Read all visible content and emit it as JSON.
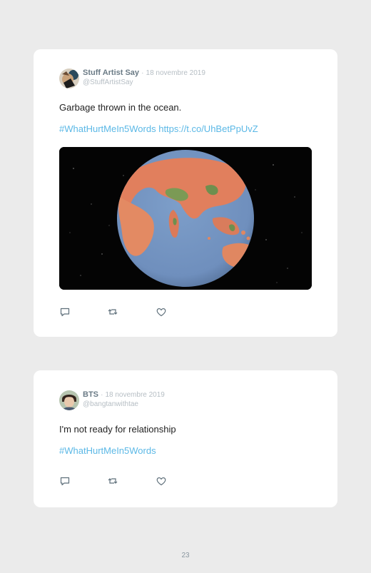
{
  "tweets": [
    {
      "author": "Stuff Artist Say",
      "separator": "·",
      "date": "18 novembre 2019",
      "handle": "@StuffArtistSay",
      "text": "Garbage thrown in the ocean.",
      "hashtag": "#WhatHurtMeIn5Words",
      "link": "https://t.co/UhBetPpUvZ",
      "media": "globe-image",
      "actions": [
        "reply-icon",
        "retweet-icon",
        "like-icon"
      ]
    },
    {
      "author": "BTS",
      "separator": "·",
      "date": "18 novembre 2019",
      "handle": "@bangtanwithtae",
      "text": "I'm not ready for relationship",
      "hashtag": "#WhatHurtMeIn5Words",
      "actions": [
        "reply-icon",
        "retweet-icon",
        "like-icon"
      ]
    }
  ],
  "page": {
    "number": "23"
  },
  "colors": {
    "background": "#ebebeb",
    "card": "#ffffff",
    "link": "#5bb8e6",
    "author": "#6b7b86",
    "muted": "#b6bec4"
  }
}
